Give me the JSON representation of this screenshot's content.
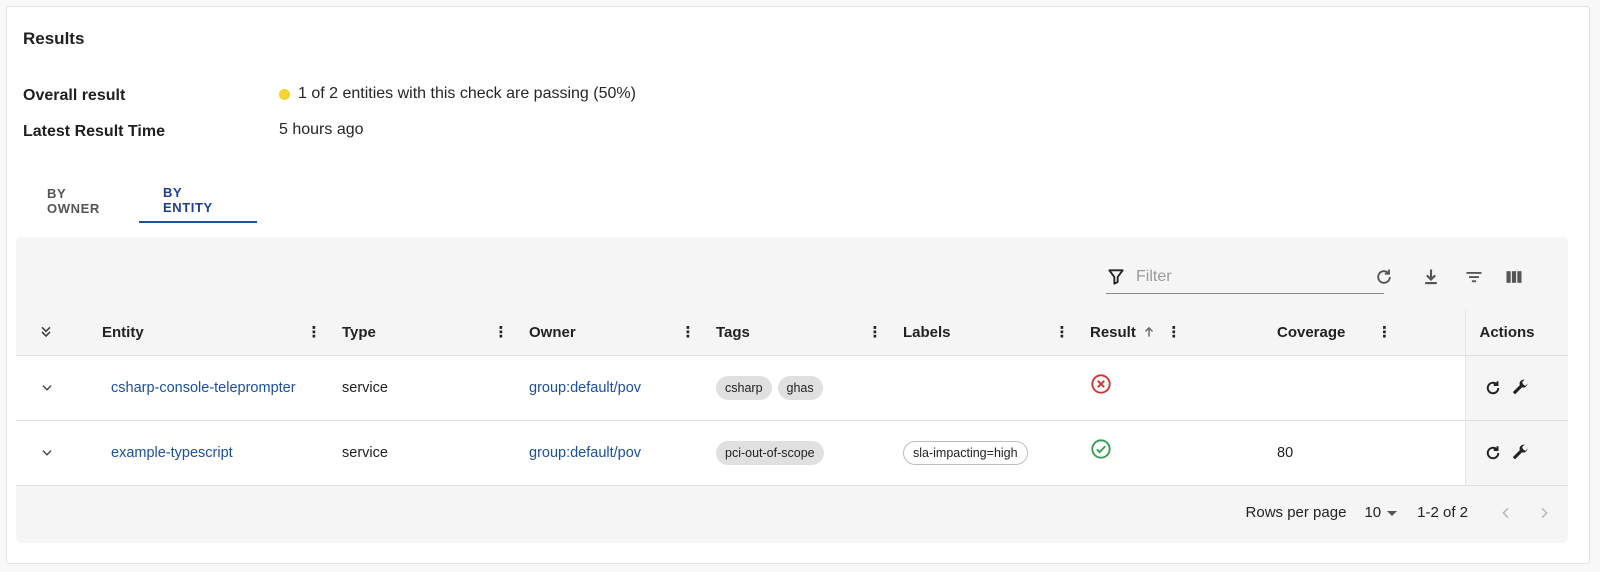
{
  "results": {
    "title": "Results",
    "overall_label": "Overall result",
    "overall_value": "1 of 2 entities with this check are passing (50%)",
    "overall_status_color": "#f5d330",
    "latest_label": "Latest Result Time",
    "latest_value": "5 hours ago"
  },
  "tabs": [
    {
      "label": "BY OWNER",
      "active": false
    },
    {
      "label": "BY ENTITY",
      "active": true
    }
  ],
  "toolbar": {
    "filter_placeholder": "Filter",
    "icons": [
      "filter-icon",
      "refresh-icon",
      "download-icon",
      "filter-list-icon",
      "view-columns-icon"
    ]
  },
  "table": {
    "columns": {
      "entity": "Entity",
      "type": "Type",
      "owner": "Owner",
      "tags": "Tags",
      "labels": "Labels",
      "result": "Result",
      "coverage": "Coverage",
      "actions": "Actions"
    },
    "rows": [
      {
        "entity": "csharp-console-teleprompter",
        "type": "service",
        "owner": "group:default/pov",
        "tags": [
          "csharp",
          "ghas"
        ],
        "labels": [],
        "result": "fail",
        "coverage": ""
      },
      {
        "entity": "example-typescript",
        "type": "service",
        "owner": "group:default/pov",
        "tags": [
          "pci-out-of-scope"
        ],
        "labels": [
          "sla-impacting=high"
        ],
        "result": "pass",
        "coverage": "80"
      }
    ]
  },
  "pagination": {
    "rows_per_page_label": "Rows per page",
    "rows_per_page_value": "10",
    "range": "1-2 of 2"
  },
  "colors": {
    "link": "#1d4fa3",
    "pass": "#2e9e4f",
    "fail": "#d32f2f",
    "tab_active": "#1d4fa3"
  }
}
